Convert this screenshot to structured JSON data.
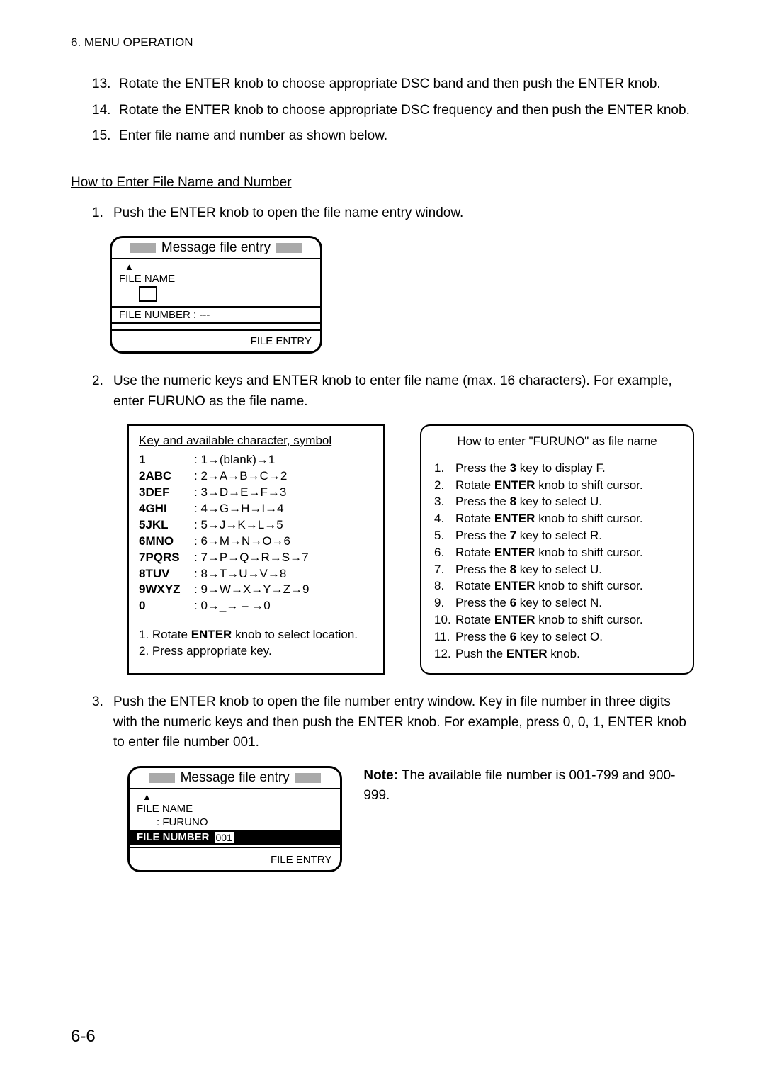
{
  "header": "6. MENU OPERATION",
  "steps": {
    "s13": {
      "num": "13.",
      "text": "Rotate the ENTER knob to choose appropriate DSC band and then push the ENTER knob."
    },
    "s14": {
      "num": "14.",
      "text": "Rotate the ENTER knob to choose appropriate DSC frequency and then push the ENTER knob."
    },
    "s15": {
      "num": "15.",
      "text": "Enter file name and number as shown below."
    }
  },
  "subsection_title": "How to Enter File Name and Number",
  "sub_steps": {
    "s1": {
      "num": "1.",
      "text": "Push the ENTER knob to open the file name entry window."
    },
    "s2": {
      "num": "2.",
      "text": "Use the numeric keys and ENTER knob to enter file name (max. 16 characters). For example, enter FURUNO as the file name."
    },
    "s3": {
      "num": "3.",
      "text": "Push the ENTER knob to open the file number entry window. Key in file number in three digits with the numeric keys and then push the ENTER knob. For example, press 0, 0, 1, ENTER knob to enter file number 001."
    }
  },
  "lcd1": {
    "title": "Message file entry",
    "file_name_label": "FILE NAME",
    "file_number_label": "FILE NUMBER : ---",
    "file_entry": "FILE ENTRY"
  },
  "key_box": {
    "header": "Key and available character, symbol",
    "rows": [
      {
        "label": "1",
        "chars": ": 1→(blank)→1"
      },
      {
        "label": "2ABC",
        "chars": ": 2→A→B→C→2"
      },
      {
        "label": "3DEF",
        "chars": ": 3→D→E→F→3"
      },
      {
        "label": "4GHI",
        "chars": ": 4→G→H→I→4"
      },
      {
        "label": "5JKL",
        "chars": ": 5→J→K→L→5"
      },
      {
        "label": "6MNO",
        "chars": ": 6→M→N→O→6"
      },
      {
        "label": "7PQRS",
        "chars": ": 7→P→Q→R→S→7"
      },
      {
        "label": "8TUV",
        "chars": ": 8→T→U→V→8"
      },
      {
        "label": "9WXYZ",
        "chars": ": 9→W→X→Y→Z→9"
      },
      {
        "label": "0",
        "chars": ": 0→_→ – →0"
      }
    ],
    "note1_pre": "1. Rotate ",
    "note1_bold": "ENTER",
    "note1_post": " knob to select location.",
    "note2": "2. Press appropriate key."
  },
  "howto_box": {
    "header": "How to enter \"FURUNO\" as file name",
    "steps": [
      {
        "num": "1.",
        "pre": "Press the ",
        "bold": "3",
        "post": " key to display F."
      },
      {
        "num": "2.",
        "pre": "Rotate ",
        "bold": "ENTER",
        "post": " knob to shift cursor."
      },
      {
        "num": "3.",
        "pre": "Press the ",
        "bold": "8",
        "post": " key to select U."
      },
      {
        "num": "4.",
        "pre": "Rotate ",
        "bold": "ENTER",
        "post": " knob to shift cursor."
      },
      {
        "num": "5.",
        "pre": "Press the ",
        "bold": "7",
        "post": " key to select R."
      },
      {
        "num": "6.",
        "pre": "Rotate ",
        "bold": "ENTER",
        "post": " knob to shift cursor."
      },
      {
        "num": "7.",
        "pre": "Press the ",
        "bold": "8",
        "post": " key to select U."
      },
      {
        "num": "8.",
        "pre": "Rotate ",
        "bold": "ENTER",
        "post": " knob to shift cursor."
      },
      {
        "num": "9.",
        "pre": "Press the ",
        "bold": "6",
        "post": " key to select N."
      },
      {
        "num": "10.",
        "pre": "Rotate ",
        "bold": "ENTER",
        "post": " knob to shift cursor."
      },
      {
        "num": "11.",
        "pre": "Press the ",
        "bold": "6",
        "post": " key to select O."
      },
      {
        "num": "12.",
        "pre": "Push the ",
        "bold": "ENTER",
        "post": " knob."
      }
    ]
  },
  "lcd2": {
    "title": "Message file entry",
    "file_name_label": "FILE NAME",
    "file_name_value": ": FURUNO",
    "file_number_label": "FILE NUMBER",
    "file_number_value": "001",
    "file_entry": "FILE ENTRY"
  },
  "note": {
    "bold": "Note:",
    "text": " The available file number is 001-799 and 900-999."
  },
  "page_number": "6-6"
}
